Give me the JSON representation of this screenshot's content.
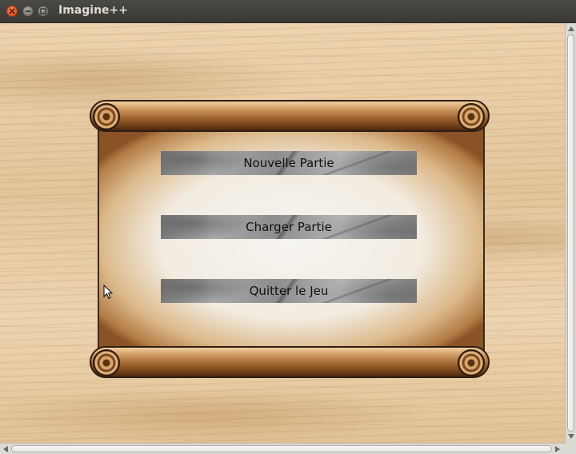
{
  "window": {
    "title": "Imagine++",
    "controls": {
      "close_icon": "close-icon",
      "minimize_icon": "minimize-icon",
      "maximize_icon": "maximize-icon"
    }
  },
  "menu": {
    "new_game": "Nouvelle Partie",
    "load_game": "Charger Partie",
    "quit_game": "Quitter le Jeu"
  },
  "colors": {
    "titlebar": "#3c3b37",
    "close_button": "#e0501f",
    "title_text": "#dfdbd2",
    "button_text": "#111111",
    "wood_background": "#e8cca5",
    "parchment": "#f4f0e8"
  }
}
